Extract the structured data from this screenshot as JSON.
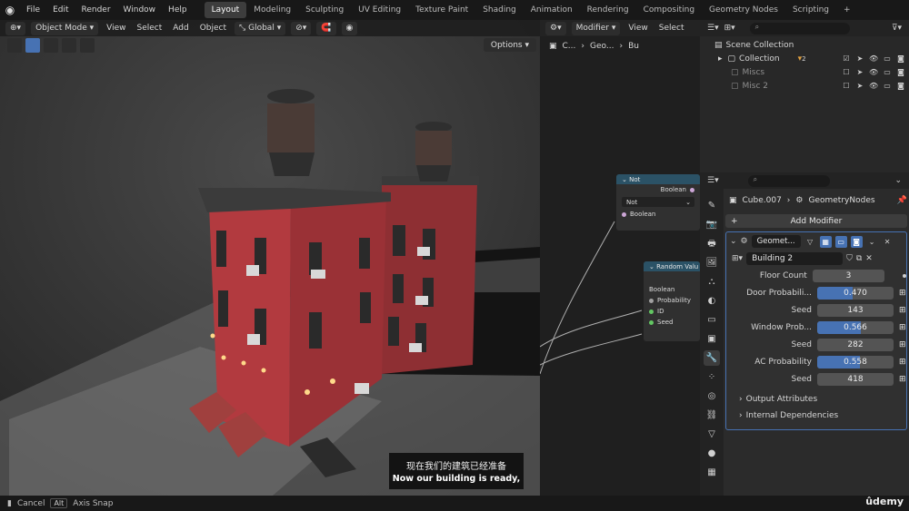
{
  "topbar": {
    "menus": [
      "File",
      "Edit",
      "Render",
      "Window",
      "Help"
    ],
    "workspaces": [
      "Layout",
      "Modeling",
      "Sculpting",
      "UV Editing",
      "Texture Paint",
      "Shading",
      "Animation",
      "Rendering",
      "Compositing",
      "Geometry Nodes",
      "Scripting"
    ],
    "active_workspace": "Layout",
    "add_tab": "+"
  },
  "viewport": {
    "mode": "Object Mode",
    "menus": [
      "View",
      "Select",
      "Add",
      "Object"
    ],
    "orientation": "Global",
    "options": "Options"
  },
  "subtitle": {
    "cn": "现在我们的建筑已经准备",
    "en": "Now our building is ready,"
  },
  "node_editor": {
    "editor_type": "Modifier",
    "menus": [
      "View",
      "Select"
    ],
    "breadcrumb": [
      "C...",
      "Geo...",
      "Bu"
    ],
    "not_node": {
      "title": "Not",
      "output": "Boolean",
      "operation": "Not",
      "input": "Boolean"
    },
    "random_node": {
      "title": "Random Valu",
      "output": "Boolean",
      "inputs": [
        "Probability",
        "ID",
        "Seed"
      ]
    }
  },
  "outliner": {
    "scene_collection": "Scene Collection",
    "items": [
      {
        "label": "Collection",
        "badge": "2"
      },
      {
        "label": "Miscs"
      },
      {
        "label": "Misc 2"
      }
    ]
  },
  "properties": {
    "object": "Cube.007",
    "modifier_path": "GeometryNodes",
    "add_modifier": "Add Modifier",
    "modifier_name": "Geomet...",
    "node_group": "Building 2",
    "params": [
      {
        "label": "Floor Count",
        "value": "3",
        "slider": false
      },
      {
        "label": "Door Probabili...",
        "value": "0.470",
        "slider": true,
        "fraction": 0.47
      },
      {
        "label": "Seed",
        "value": "143",
        "slider": false
      },
      {
        "label": "Window Prob...",
        "value": "0.566",
        "slider": true,
        "fraction": 0.566
      },
      {
        "label": "Seed",
        "value": "282",
        "slider": false
      },
      {
        "label": "AC Probability",
        "value": "0.558",
        "slider": true,
        "fraction": 0.558
      },
      {
        "label": "Seed",
        "value": "418",
        "slider": false
      }
    ],
    "subpanels": [
      "Output Attributes",
      "Internal Dependencies"
    ]
  },
  "statusbar": {
    "cancel": "Cancel",
    "alt_key": "Alt",
    "axis_snap": "Axis Snap",
    "watermark": "ûdemy"
  },
  "colors": {
    "accent": "#4772b3",
    "not_node_header": "#2b5266",
    "random_node_header": "#2b5266",
    "brick": "#a6353a"
  }
}
